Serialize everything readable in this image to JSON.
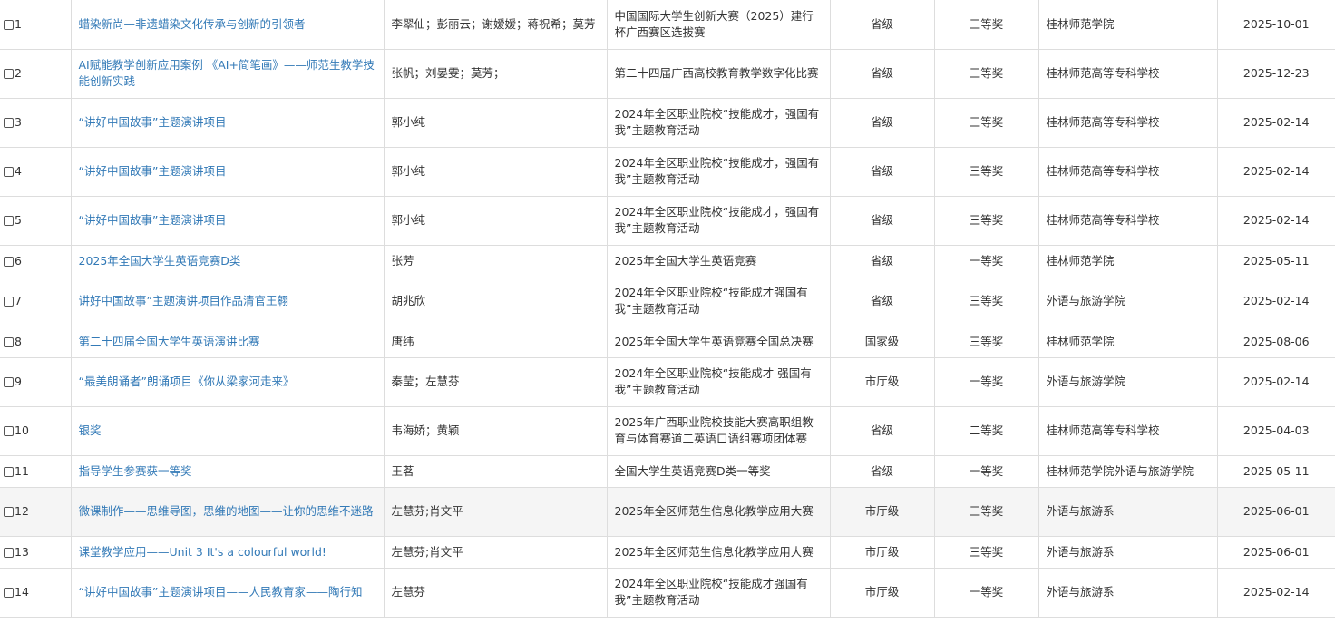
{
  "colors": {
    "link": "#337ab7",
    "text": "#333333",
    "border": "#dddddd",
    "highlight_row": "#f5f5f5"
  },
  "rows": [
    {
      "no": "1",
      "title": "蜡染新尚—非遗蜡染文化传承与创新的引领者",
      "members": "李翠仙；彭丽云；谢嫒嫒；蒋祝希；莫芳",
      "competition": "中国国际大学生创新大赛（2025）建行杯广西赛区选拔赛",
      "level": "省级",
      "award": "三等奖",
      "unit": "桂林师范学院",
      "date": "2025-10-01"
    },
    {
      "no": "2",
      "title": "AI赋能教学创新应用案例 《AI+简笔画》——师范生教学技能创新实践",
      "members": "张帆；刘晏雯；莫芳；",
      "competition": "第二十四届广西高校教育教学数字化比赛",
      "level": "省级",
      "award": "三等奖",
      "unit": "桂林师范高等专科学校",
      "date": "2025-12-23"
    },
    {
      "no": "3",
      "title": "“讲好中国故事”主题演讲项目",
      "members": "郭小纯",
      "competition": "2024年全区职业院校“技能成才，强国有我”主题教育活动",
      "level": "省级",
      "award": "三等奖",
      "unit": "桂林师范高等专科学校",
      "date": "2025-02-14"
    },
    {
      "no": "4",
      "title": "“讲好中国故事”主题演讲项目",
      "members": "郭小纯",
      "competition": "2024年全区职业院校“技能成才，强国有我”主题教育活动",
      "level": "省级",
      "award": "三等奖",
      "unit": "桂林师范高等专科学校",
      "date": "2025-02-14"
    },
    {
      "no": "5",
      "title": "“讲好中国故事”主题演讲项目",
      "members": "郭小纯",
      "competition": "2024年全区职业院校“技能成才，强国有我”主题教育活动",
      "level": "省级",
      "award": "三等奖",
      "unit": "桂林师范高等专科学校",
      "date": "2025-02-14"
    },
    {
      "no": "6",
      "title": "2025年全国大学生英语竞赛D类",
      "members": "张芳",
      "competition": "2025年全国大学生英语竞赛",
      "level": "省级",
      "award": "一等奖",
      "unit": "桂林师范学院",
      "date": "2025-05-11"
    },
    {
      "no": "7",
      "title": "讲好中国故事”主题演讲项目作品清官王翱",
      "members": "胡兆欣",
      "competition": "2024年全区职业院校“技能成才强国有我”主题教育活动",
      "level": "省级",
      "award": "三等奖",
      "unit": "外语与旅游学院",
      "date": "2025-02-14"
    },
    {
      "no": "8",
      "title": "第二十四届全国大学生英语演讲比赛",
      "members": "唐纬",
      "competition": "2025年全国大学生英语竞赛全国总决赛",
      "level": "国家级",
      "award": "三等奖",
      "unit": "桂林师范学院",
      "date": "2025-08-06"
    },
    {
      "no": "9",
      "title": "“最美朗诵者”朗诵项目《你从梁家河走来》",
      "members": "秦莹；左慧芬",
      "competition": "2024年全区职业院校“技能成才 强国有我”主题教育活动",
      "level": "市厅级",
      "award": "一等奖",
      "unit": "外语与旅游学院",
      "date": "2025-02-14"
    },
    {
      "no": "10",
      "title": "银奖",
      "members": "韦海娇；黄颖",
      "competition": "2025年广西职业院校技能大赛高职组教育与体育赛道二英语口语组赛项团体赛",
      "level": "省级",
      "award": "二等奖",
      "unit": "桂林师范高等专科学校",
      "date": "2025-04-03"
    },
    {
      "no": "11",
      "title": "指导学生参赛获一等奖",
      "members": "王茗",
      "competition": "全国大学生英语竞赛D类一等奖",
      "level": "省级",
      "award": "一等奖",
      "unit": "桂林师范学院外语与旅游学院",
      "date": "2025-05-11"
    },
    {
      "no": "12",
      "title": "微课制作——思维导图，思维的地图——让你的思维不迷路",
      "members": "左慧芬;肖文平",
      "competition": "2025年全区师范生信息化教学应用大赛",
      "level": "市厅级",
      "award": "三等奖",
      "unit": "外语与旅游系",
      "date": "2025-06-01"
    },
    {
      "no": "13",
      "title": "课堂教学应用——Unit 3 It's a colourful world!",
      "members": "左慧芬;肖文平",
      "competition": "2025年全区师范生信息化教学应用大赛",
      "level": "市厅级",
      "award": "三等奖",
      "unit": "外语与旅游系",
      "date": "2025-06-01"
    },
    {
      "no": "14",
      "title": "“讲好中国故事”主题演讲项目——人民教育家——陶行知",
      "members": "左慧芬",
      "competition": "2024年全区职业院校“技能成才强国有我”主题教育活动",
      "level": "市厅级",
      "award": "一等奖",
      "unit": "外语与旅游系",
      "date": "2025-02-14"
    }
  ]
}
